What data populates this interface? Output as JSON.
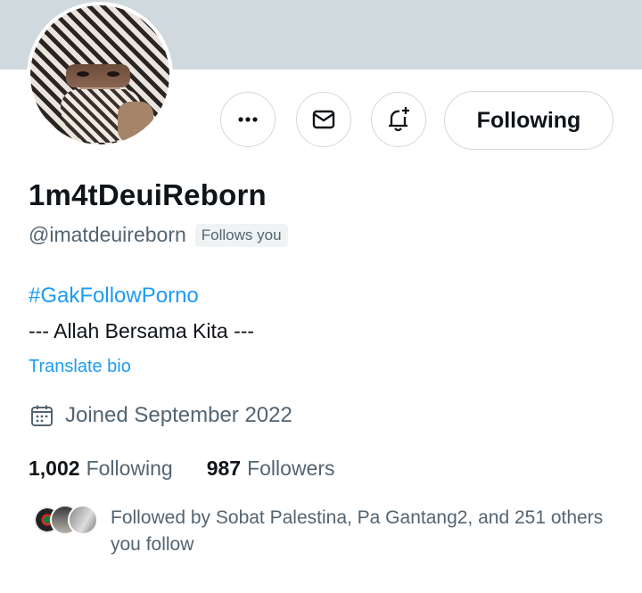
{
  "profile": {
    "display_name": "1m4tDeuiReborn",
    "handle": "@imatdeuireborn",
    "follows_you_badge": "Follows you",
    "hashtag": "#GakFollowPorno",
    "bio_line": "--- Allah Bersama Kita ---",
    "translate_bio": "Translate bio",
    "joined": "Joined September 2022"
  },
  "actions": {
    "more_icon": "more-horizontal",
    "message_icon": "envelope",
    "notify_icon": "bell-plus",
    "follow_label": "Following"
  },
  "stats": {
    "following_count": "1,002",
    "following_label": "Following",
    "followers_count": "987",
    "followers_label": "Followers"
  },
  "followed_by": "Followed by Sobat Palestina, Pa Gantang2, and 251 others you follow",
  "colors": {
    "accent": "#1d9bf0",
    "muted": "#536471",
    "banner": "#cfd9de"
  }
}
